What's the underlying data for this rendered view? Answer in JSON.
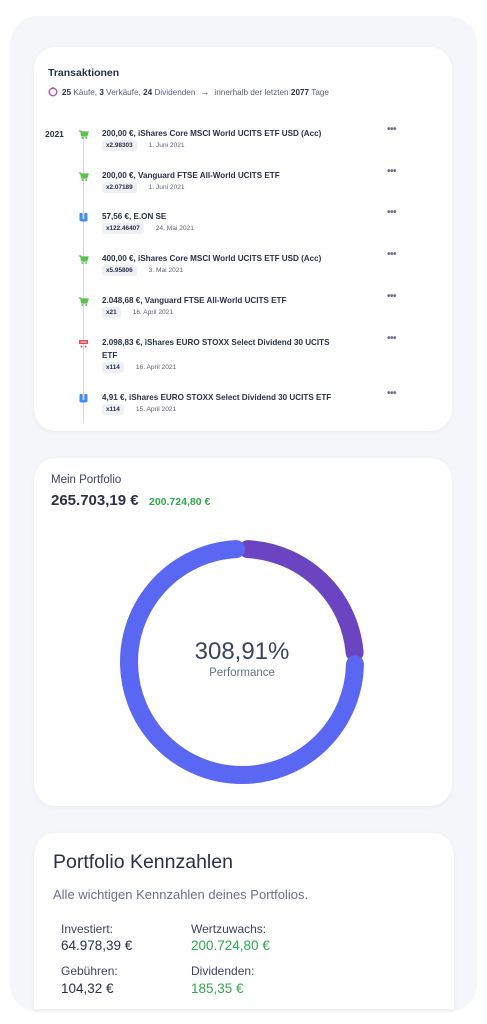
{
  "transactions": {
    "title": "Transaktionen",
    "summary": {
      "buys_count": "25",
      "buys_label": " Käufe, ",
      "sells_count": "3",
      "sells_label": " Verkäufe, ",
      "dividends_count": "24",
      "dividends_label": " Dividenden",
      "arrow": "→",
      "period_prefix": "innerhalb der letzten ",
      "days": "2077",
      "period_suffix": " Tage"
    },
    "year": "2021",
    "items": [
      {
        "type": "buy",
        "text": "200,00 €, iShares Core MSCI World UCITS ETF USD (Acc)",
        "qty": "x2.98303",
        "date": "1. Juni 2021",
        "more": "•••"
      },
      {
        "type": "buy",
        "text": "200,00 €, Vanguard FTSE All-World UCITS ETF",
        "qty": "x2.07189",
        "date": "1. Juni 2021",
        "more": "•••"
      },
      {
        "type": "dividend",
        "text": "57,56 €, E.ON SE",
        "qty": "x122.46407",
        "date": "24. Mai 2021",
        "more": "•••"
      },
      {
        "type": "buy",
        "text": "400,00 €, iShares Core MSCI World UCITS ETF USD (Acc)",
        "qty": "x5.95806",
        "date": "3. Mai 2021",
        "more": "•••"
      },
      {
        "type": "buy",
        "text": "2.048,68 €, Vanguard FTSE All-World UCITS ETF",
        "qty": "x21",
        "date": "16. April 2021",
        "more": "•••"
      },
      {
        "type": "sell",
        "text": "2.098,83 €, iShares EURO STOXX Select Dividend 30 UCITS ETF",
        "qty": "x114",
        "date": "16. April 2021",
        "more": "•••"
      },
      {
        "type": "dividend",
        "text": "4,91 €, iShares EURO STOXX Select Dividend 30 UCITS ETF",
        "qty": "x114",
        "date": "15. April 2021",
        "more": "•••"
      }
    ]
  },
  "portfolio": {
    "label": "Mein Portfolio",
    "value": "265.703,19 €",
    "gain": "200.724,80 €",
    "performance_value": "308,91%",
    "performance_label": "Performance",
    "donut_segments": [
      {
        "name": "invested-part",
        "fraction": 0.245,
        "color": "#6b44c2"
      },
      {
        "name": "gain-part",
        "fraction": 0.755,
        "color": "#5a67f2"
      }
    ]
  },
  "kennzahlen": {
    "title": "Portfolio Kennzahlen",
    "subtitle": "Alle wichtigen Kennzahlen deines Portfolios.",
    "investiert_label": "Investiert:",
    "investiert_value": "64.978,39 €",
    "wertzuwachs_label": "Wertzuwachs:",
    "wertzuwachs_value": "200.724,80 €",
    "gebuehren_label": "Gebühren:",
    "gebuehren_value": "104,32 €",
    "dividenden_label": "Dividenden:",
    "dividenden_value": "185,35 €"
  },
  "colors": {
    "buy": "#5cc24a",
    "sell": "#e5484d",
    "dividend": "#3f8ef0",
    "gain_green": "#2fa84f"
  },
  "icons": {
    "buy": "cart-icon",
    "sell": "cart-remove-icon",
    "dividend": "dividend-coins-icon",
    "summary": "ring-icon"
  }
}
